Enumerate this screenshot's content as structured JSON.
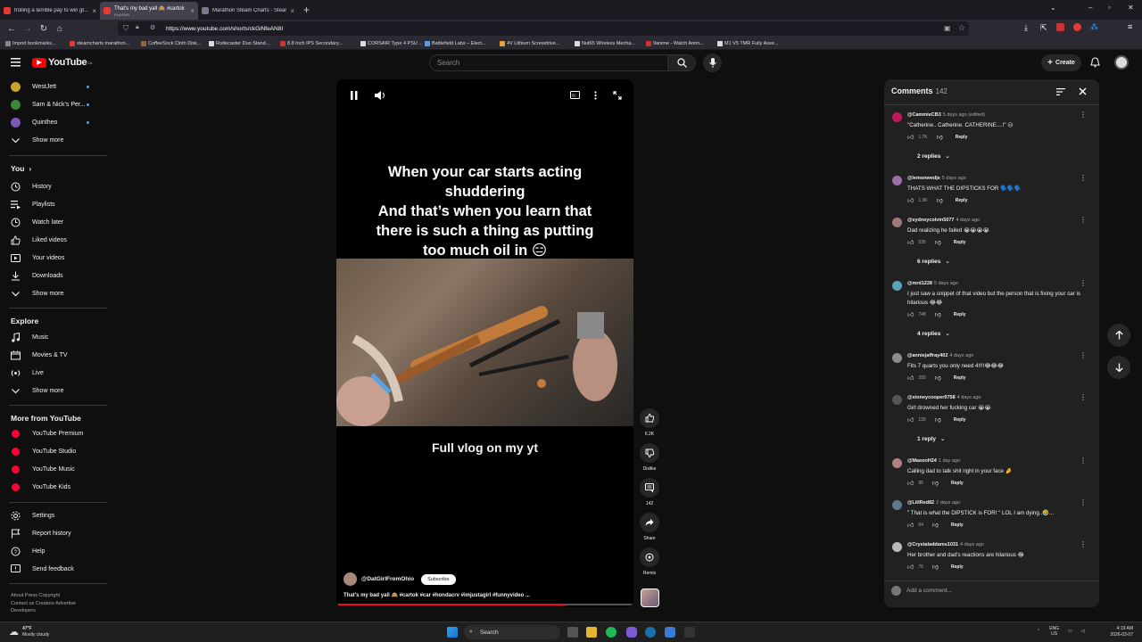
{
  "browser": {
    "tabs": [
      {
        "label": "trolling a terrible pay to win gt...",
        "sub": ""
      },
      {
        "label": "That's my bad yall 🙈 #cartok #",
        "sub": "PLAYING"
      },
      {
        "label": "Marathon Steam Charts - Steam",
        "sub": ""
      }
    ],
    "url": "https://www.youtube.com/shorts/ckGiNfeAN8I",
    "bookmarks": [
      "Import bookmarks...",
      "steamcharts marathon...",
      "CoffeeSock Cloth Disk...",
      "Rodecaster Duo Stand...",
      "8.8 Inch IPS Secondary...",
      "CORSAIR Type 4 PSU ...",
      "Battlefield Labs – Elect...",
      "4V Lithium Screwdrive...",
      "Nut65 Wireless Mecha...",
      "9anime - Watch Anim...",
      "M1 V5 TMR Fully Asse..."
    ]
  },
  "header": {
    "logo": "YouTube",
    "region": "CA",
    "search_placeholder": "Search",
    "create_label": "Create"
  },
  "sidebar": {
    "subs": [
      {
        "label": "WestJett",
        "color": "#c9a227"
      },
      {
        "label": "Sam & Nick's Per...",
        "color": "#3b8a3b"
      },
      {
        "label": "Quintheo",
        "color": "#7a5ab5"
      }
    ],
    "show_more": "Show more",
    "you_head": "You",
    "you_items": [
      "History",
      "Playlists",
      "Watch later",
      "Liked videos",
      "Your videos",
      "Downloads",
      "Show more"
    ],
    "explore_head": "Explore",
    "explore_items": [
      "Music",
      "Movies & TV",
      "Live",
      "Show more"
    ],
    "more_head": "More from YouTube",
    "more_items": [
      "YouTube Premium",
      "YouTube Studio",
      "YouTube Music",
      "YouTube Kids"
    ],
    "settings_items": [
      "Settings",
      "Report history",
      "Help",
      "Send feedback"
    ],
    "footer1": "About  Press  Copyright",
    "footer2": "Contact us  Creators  Advertise",
    "footer3": "Developers"
  },
  "video": {
    "caption_lines": [
      "When your car starts acting",
      "shuddering",
      "And that’s when you learn that",
      "there is such a thing as putting",
      "too much oil in 😑"
    ],
    "subcaption": "Full vlog on my yt",
    "channel": "@DatGirlFromOhio",
    "subscribe": "Subscribe",
    "title": "That's my bad yall 🙈 #cartok #car #hondacrv #imjustagirl #funnyvideo ...",
    "progress": 0.77
  },
  "actions": {
    "likes": "6.2K",
    "dislike": "Dislike",
    "comments": "142",
    "share": "Share",
    "remix": "Remix"
  },
  "comments": {
    "title": "Comments",
    "count": "142",
    "add_placeholder": "Add a comment...",
    "items": [
      {
        "user": "@CammieCB3",
        "time": "5 days ago (edited)",
        "text": "\"Catherine.. Catherine. CATHERINE....!\" 😑",
        "likes": "1.7K",
        "reply": "Reply",
        "replies": "2 replies",
        "color": "#c2185b"
      },
      {
        "user": "@lemonwedje",
        "time": "5 days ago",
        "text": "THATS WHAT THE DIPSTICKS FOR 🗣️🗣️🗣️",
        "likes": "1.3K",
        "reply": "Reply",
        "replies": "",
        "color": "#9c6fa8"
      },
      {
        "user": "@sydneycolvin5077",
        "time": "4 days ago",
        "text": "Dad realizing he failed 😭😭😭😭",
        "likes": "535",
        "reply": "Reply",
        "replies": "6 replies",
        "color": "#a07a7a"
      },
      {
        "user": "@mrd1228",
        "time": "5 days ago",
        "text": "I just saw a snippet of that video but the person that is fixing your car is hilarious 😂😂",
        "likes": "748",
        "reply": "Reply",
        "replies": "4 replies",
        "color": "#5aa3b8"
      },
      {
        "user": "@anniejaffray402",
        "time": "4 days ago",
        "text": "Fits 7 quarts you only need 4!!!!😂😂😂",
        "likes": "293",
        "reply": "Reply",
        "replies": "",
        "color": "#8d8d8d"
      },
      {
        "user": "@stoneycooper9758",
        "time": "4 days ago",
        "text": "Girl drowned her fucking car 😭😭",
        "likes": "130",
        "reply": "Reply",
        "replies": "1 reply",
        "color": "#555555"
      },
      {
        "user": "@MasonH24",
        "time": "1 day ago",
        "text": "Calling dad to talk shit right in your face 🤌",
        "likes": "95",
        "reply": "Reply",
        "replies": "",
        "color": "#b08080"
      },
      {
        "user": "@LitlRed82",
        "time": "2 days ago",
        "text": "\" That is what the DIPSTICK is FOR! \" LOL I am dying..🤣...",
        "likes": "64",
        "reply": "Reply",
        "replies": "",
        "color": "#5c7a8a"
      },
      {
        "user": "@Crystaladdams1031",
        "time": "4 days ago",
        "text": "Her brother and dad's reactions are hilarious 😂",
        "likes": "75",
        "reply": "Reply",
        "replies": "",
        "color": "#bbbbbb"
      }
    ]
  },
  "taskbar": {
    "temp": "47°F",
    "weather": "Mostly cloudy",
    "search": "Search",
    "lang1": "ENG",
    "lang2": "US",
    "time": "4:19 AM",
    "date": "2026-03-07"
  }
}
